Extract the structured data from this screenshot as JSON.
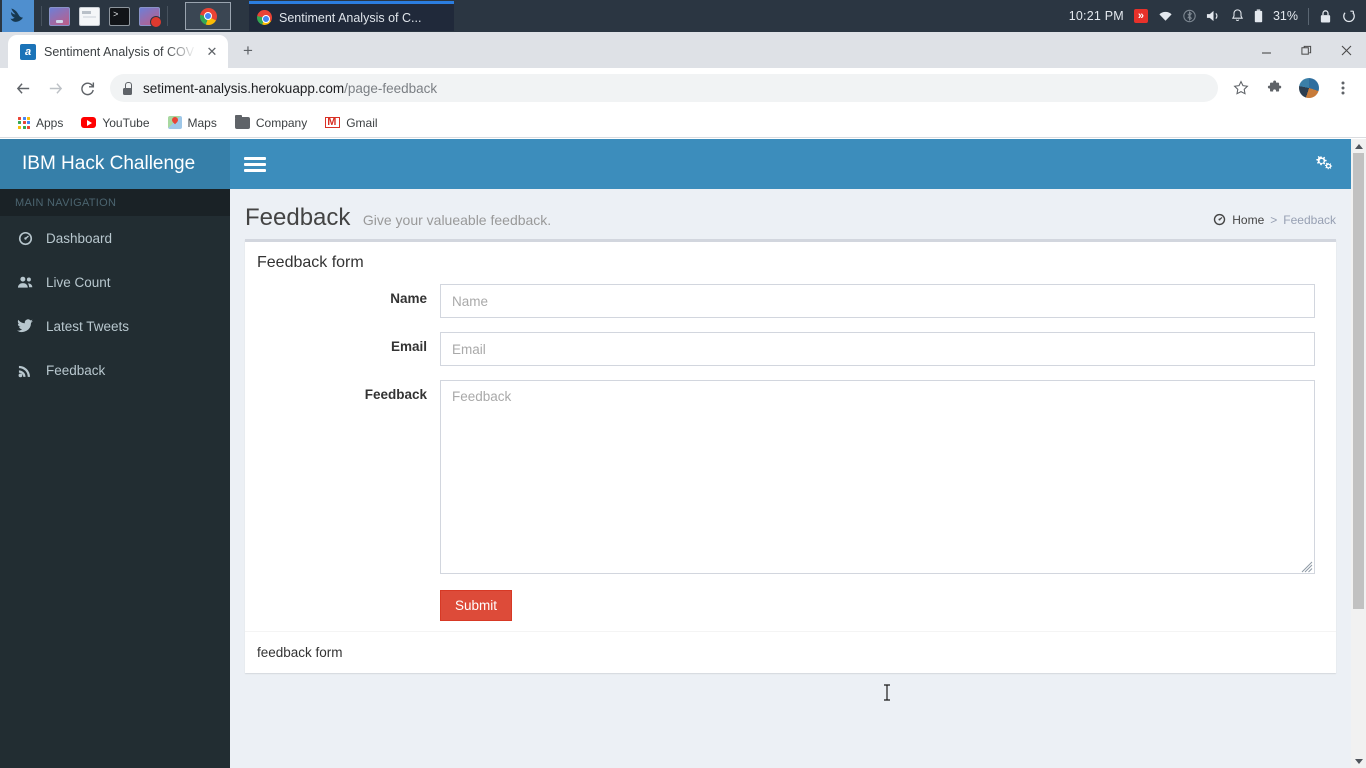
{
  "os_taskbar": {
    "logo_icon": "dragon-logo-icon",
    "quick_launch": [
      {
        "name": "files-app-icon"
      },
      {
        "name": "file-manager-icon"
      },
      {
        "name": "terminal-icon"
      },
      {
        "name": "screen-recorder-icon"
      }
    ],
    "active_task_icon": "chrome-icon",
    "window_button": {
      "icon": "chrome-icon",
      "title": "Sentiment Analysis of C..."
    },
    "clock": "10:21 PM",
    "tray": {
      "badge_icon": "chevrons-badge-icon",
      "wifi_icon": "wifi-icon",
      "bluetooth_icon": "bluetooth-icon",
      "volume_icon": "volume-icon",
      "notification_icon": "bell-icon",
      "battery_icon": "battery-icon",
      "battery_percent": "31%",
      "lock_icon": "lock-icon",
      "power_icon": "power-icon"
    }
  },
  "browser": {
    "tab": {
      "title": "Sentiment Analysis of COV",
      "favicon": "site-favicon",
      "close_icon": "close-icon"
    },
    "new_tab_icon": "plus-icon",
    "window_controls": {
      "minimize": "minimize-icon",
      "restore": "restore-icon",
      "close": "close-icon"
    },
    "toolbar": {
      "back_icon": "back-arrow-icon",
      "forward_icon": "forward-arrow-icon",
      "reload_icon": "reload-icon",
      "lock_icon": "lock-icon",
      "url_domain": "setiment-analysis.herokuapp.com",
      "url_path": "/page-feedback",
      "bookmark_star_icon": "star-icon",
      "extensions_icon": "puzzle-icon",
      "profile_icon": "avatar-icon",
      "menu_icon": "three-dot-menu-icon"
    },
    "bookmarks": [
      {
        "label": "Apps",
        "icon": "apps-grid-icon"
      },
      {
        "label": "YouTube",
        "icon": "youtube-icon"
      },
      {
        "label": "Maps",
        "icon": "maps-icon"
      },
      {
        "label": "Company",
        "icon": "folder-icon"
      },
      {
        "label": "Gmail",
        "icon": "gmail-icon"
      }
    ]
  },
  "app": {
    "brand": "IBM Hack Challenge",
    "navbar": {
      "toggle_icon": "hamburger-icon",
      "settings_icon": "cogs-icon"
    },
    "sidebar": {
      "section_label": "MAIN NAVIGATION",
      "items": [
        {
          "label": "Dashboard",
          "icon": "dashboard-icon"
        },
        {
          "label": "Live Count",
          "icon": "users-icon"
        },
        {
          "label": "Latest Tweets",
          "icon": "twitter-icon"
        },
        {
          "label": "Feedback",
          "icon": "rss-icon"
        }
      ]
    },
    "page": {
      "title": "Feedback",
      "subtitle": "Give your valueable feedback.",
      "breadcrumb": {
        "home_icon": "dashboard-icon",
        "home": "Home",
        "separator": ">",
        "current": "Feedback"
      }
    },
    "box": {
      "title": "Feedback form",
      "footer": "feedback form",
      "fields": [
        {
          "label": "Name",
          "placeholder": "Name",
          "value": "",
          "type": "text"
        },
        {
          "label": "Email",
          "placeholder": "Email",
          "value": "",
          "type": "text"
        },
        {
          "label": "Feedback",
          "placeholder": "Feedback",
          "value": "",
          "type": "textarea"
        }
      ],
      "submit_label": "Submit"
    }
  },
  "colors": {
    "navbar_blue": "#3c8dbc",
    "logo_blue": "#367fa9",
    "sidebar_dark": "#222d32",
    "submit_red": "#dd4b39",
    "content_bg": "#ecf0f5"
  }
}
